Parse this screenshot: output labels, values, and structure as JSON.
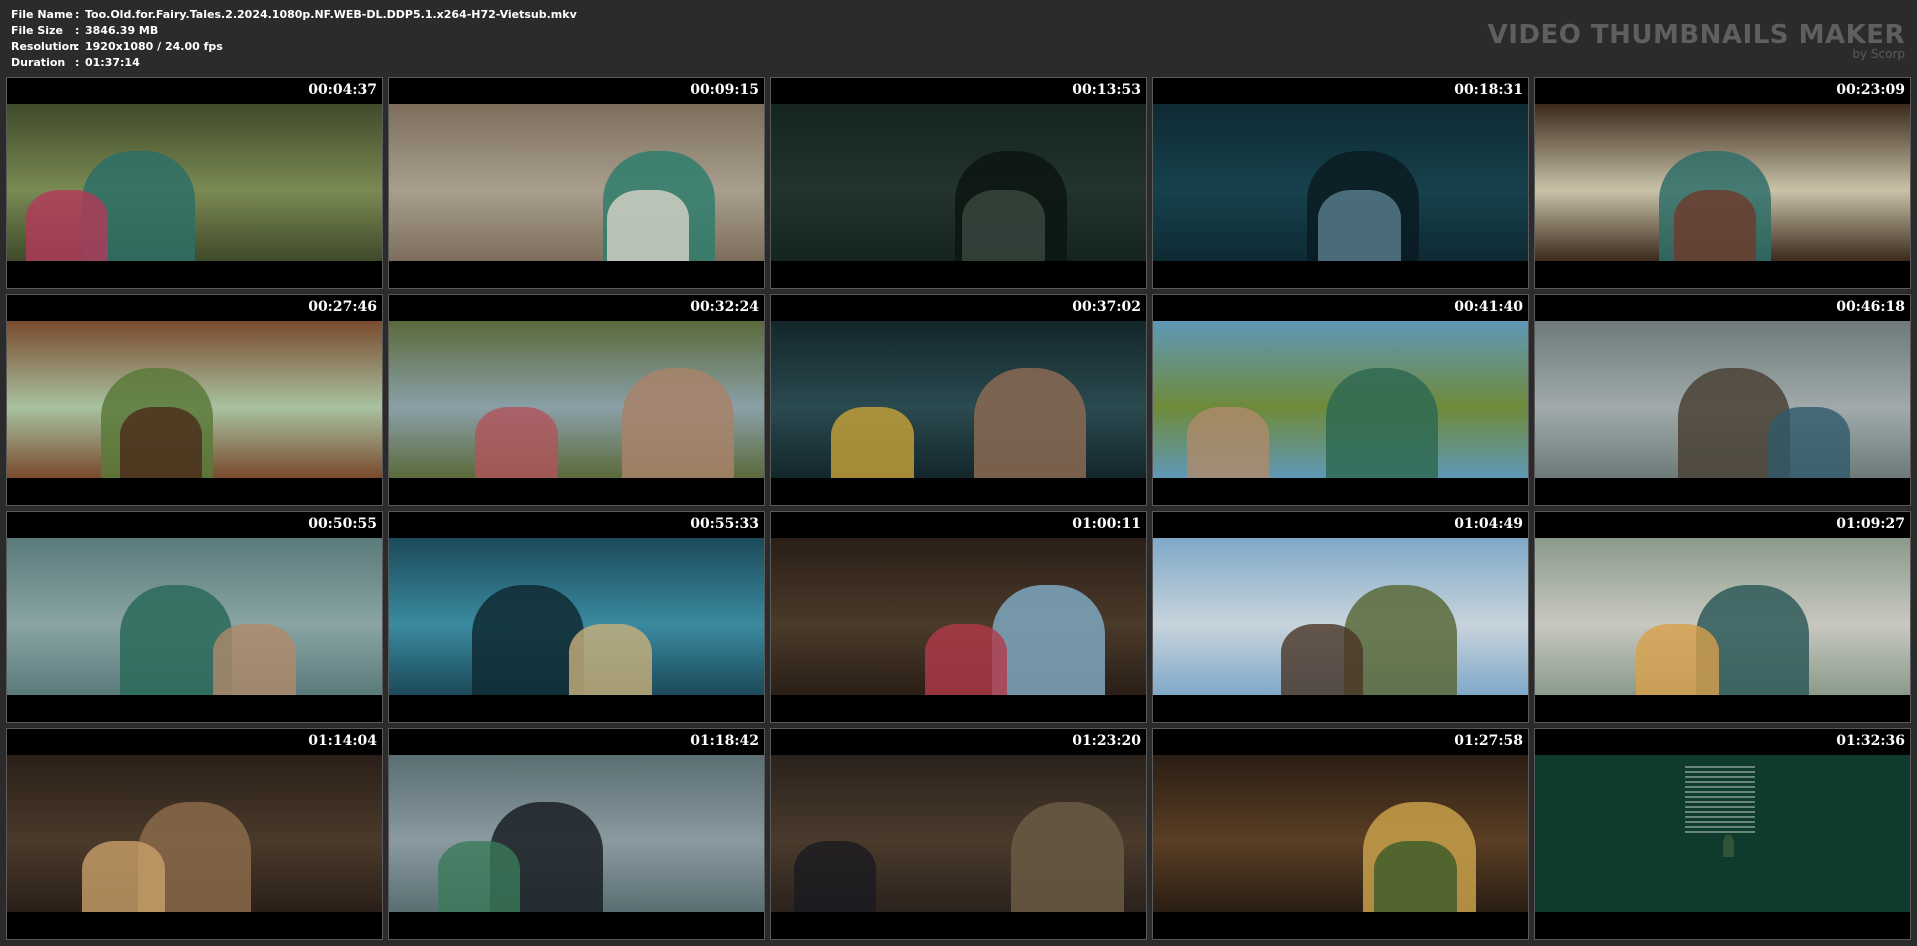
{
  "header": {
    "rows": [
      {
        "key": "File Name",
        "sep": ":",
        "value": "Too.Old.for.Fairy.Tales.2.2024.1080p.NF.WEB-DL.DDP5.1.x264-H72-Vietsub.mkv"
      },
      {
        "key": "File Size",
        "sep": ":",
        "value": "3846.39 MB"
      },
      {
        "key": "Resolution",
        "sep": ":",
        "value": "1920x1080 / 24.00 fps"
      },
      {
        "key": "Duration",
        "sep": ":",
        "value": "01:37:14"
      }
    ]
  },
  "brand": {
    "title": "VIDEO THUMBNAILS MAKER",
    "subtitle": "by Scorp"
  },
  "thumbnails": [
    {
      "time": "00:04:37",
      "scene": "stairs-jacket",
      "colors": [
        "#3f4a2a",
        "#7a8a52",
        "#2d6f66",
        "#b33a5a"
      ]
    },
    {
      "time": "00:09:15",
      "scene": "rocky-slope-backpacks",
      "colors": [
        "#7d6e5c",
        "#a89e8e",
        "#2f7d6b",
        "#d8d4c8"
      ]
    },
    {
      "time": "00:13:53",
      "scene": "night-figures",
      "colors": [
        "#15241f",
        "#22342d",
        "#0c1512",
        "#3a4a40"
      ]
    },
    {
      "time": "00:18:31",
      "scene": "dark-teal-jackets",
      "colors": [
        "#0e2a33",
        "#16414c",
        "#0a1b22",
        "#5a8090"
      ]
    },
    {
      "time": "00:23:09",
      "scene": "dining-room-window",
      "colors": [
        "#3b2a1c",
        "#c9c2a8",
        "#2f6e6a",
        "#6e3a2a"
      ]
    },
    {
      "time": "00:27:46",
      "scene": "wooden-cabin-forest",
      "colors": [
        "#7a4a2e",
        "#a8c2a0",
        "#5a7a3a",
        "#4a2a1a"
      ]
    },
    {
      "time": "00:32:24",
      "scene": "girl-field-pointing",
      "colors": [
        "#5a6a3a",
        "#8aa0a8",
        "#a8826a",
        "#b3525a"
      ]
    },
    {
      "time": "00:37:02",
      "scene": "boys-closeup-dark",
      "colors": [
        "#13262a",
        "#2a4a50",
        "#8a6a52",
        "#c9a23a"
      ]
    },
    {
      "time": "00:41:40",
      "scene": "boy-meadow-sky",
      "colors": [
        "#5f98b8",
        "#6f8a3a",
        "#2f6a52",
        "#b08a6a"
      ]
    },
    {
      "time": "00:46:18",
      "scene": "hallway-group",
      "colors": [
        "#6e7a7a",
        "#a0aaaa",
        "#4a4236",
        "#2f5a6a"
      ]
    },
    {
      "time": "00:50:55",
      "scene": "boy-concrete-room",
      "colors": [
        "#5a7a7c",
        "#8aa4a4",
        "#2a6a5a",
        "#b08a6a"
      ]
    },
    {
      "time": "00:55:33",
      "scene": "server-room-blue",
      "colors": [
        "#1c4a5a",
        "#3a8aa0",
        "#0f2a33",
        "#c9b07a"
      ]
    },
    {
      "time": "01:00:11",
      "scene": "tv-news-reporter",
      "colors": [
        "#2a1e16",
        "#4a3a2a",
        "#7fa8c0",
        "#b33a4a"
      ]
    },
    {
      "time": "01:04:49",
      "scene": "man-hat-landscape",
      "colors": [
        "#7fa8c8",
        "#c8d4dc",
        "#5a6a3a",
        "#4a3426"
      ]
    },
    {
      "time": "01:09:27",
      "scene": "boy-girl-couch",
      "colors": [
        "#8a9a8a",
        "#c8c8c0",
        "#2f5a5a",
        "#d8a04a"
      ]
    },
    {
      "time": "01:14:04",
      "scene": "table-dim-room",
      "colors": [
        "#2a1f18",
        "#4a3a2a",
        "#8a6a4a",
        "#c9a06a"
      ]
    },
    {
      "time": "01:18:42",
      "scene": "man-dark-suit",
      "colors": [
        "#5a6e72",
        "#8a9aa0",
        "#1a1f24",
        "#3a7a5a"
      ]
    },
    {
      "time": "01:23:20",
      "scene": "church-pews",
      "colors": [
        "#2a221c",
        "#4a3a2c",
        "#6a5a44",
        "#1a1a20"
      ]
    },
    {
      "time": "01:27:58",
      "scene": "chapel-flowers",
      "colors": [
        "#2a1e14",
        "#5a3e24",
        "#c8a04a",
        "#3a5a2a"
      ]
    },
    {
      "time": "01:32:36",
      "scene": "end-credits-green",
      "colors": [
        "#0f3a2e",
        "#14463a",
        "#8fa89a",
        "#3a5a3a"
      ]
    }
  ]
}
